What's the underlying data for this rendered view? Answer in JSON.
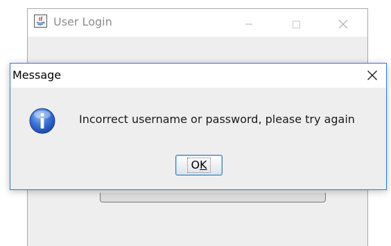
{
  "background_window": {
    "title": "User Login",
    "icon": "java-icon"
  },
  "dialog": {
    "title": "Message",
    "icon": "information-icon",
    "message": "Incorrect username or password, please try again",
    "ok_button": {
      "first": "O",
      "mnemonic": "K"
    }
  },
  "colors": {
    "dialog_border": "#2b78d8",
    "info_icon_blue": "#2a62c7",
    "background": "#eeeeee"
  }
}
